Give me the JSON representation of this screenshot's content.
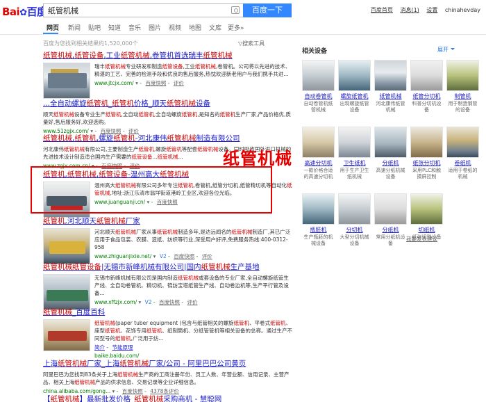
{
  "header": {
    "logo_part1": "Bai",
    "logo_paw": "✿",
    "logo_part2": "百度",
    "query": "纸管机械",
    "search_button": "百度一下",
    "links": [
      "百度首页",
      "消息(1)",
      "设置",
      "chinahevday"
    ],
    "icons": {
      "camera": "camera-icon"
    }
  },
  "nav": {
    "tabs": [
      "网页",
      "新闻",
      "贴吧",
      "知道",
      "音乐",
      "图片",
      "视频",
      "地图",
      "文库",
      "更多»"
    ],
    "active_index": 0
  },
  "result_count": "百度为您找到相关结果约1,520,000个",
  "search_tools": "搜索工具",
  "results": [
    {
      "title": "纸管机械,纸管设备,工业纸管机械,卷管机首选瑞丰纸管机械",
      "abstract": "瑞丰纸管机械专业研发和制造纸管设备,工业纸管机械,卷管机。公司将以先进的技术、精湛的工艺、完善的检测手段和优良的售后服务,热忱欢迎新老用户与我们携手共进...",
      "url": "www.jtcjx.com/",
      "snapshot": "百度快照",
      "extra": "评价"
    },
    {
      "title": "...全自动螺旋纸管机_纸管机价格_顺天纸管机械设备",
      "abstract": "顺天纸管机械设备专业生产纸管机,全自动纸管机,全自动螺旋纸管机,是知名的纸管机生产厂家,产品价格优,质量好,售后服务好,欢迎选购。",
      "url": "www.51zgjx.com/",
      "snapshot": "百度快照",
      "extra": "评价"
    },
    {
      "title": "纸管机械,纸管机,螺旋纸管机-河北康伟纸管机械制造有限公司",
      "abstract": "河北康伟纸管机械有限公司,主要制造生产纸管机,螺旋纸管机等配套纸管机械设备。同时吸收国外进口机械的先进技术设计制造适合国内生产需要的纸管设备...纸管机械...",
      "url": "www.zgjx.com.cn/",
      "snapshot": "百度快照",
      "extra": "评价"
    },
    {
      "title": "纸管机,纸管机械,纸管设备-温州高大纸管机械",
      "abstract": "温州高大纸管机械有限公司多年专注纸管机,卷管机,纸管分切机,纸管精切机等自动化纸管机械,地址:浙江乐清市翁垟街道港岭工业区,欢迎各位光临。",
      "url": "www.juanguanji.cn/",
      "snapshot": "百度快照",
      "extra": ""
    },
    {
      "title": "纸管机,河北顺天纸管机械厂家",
      "abstract": "河北顺天纸管机械厂家从事纸管机械制造多年,是达远闻名的纸管机械制造厂,其已广泛应用于食品包装、农膜、造纸、纺织等行业,深受用户好评,免费服务热线:400-0312-958",
      "url": "www.zhiguanjixie.net/",
      "v2": "V2",
      "snapshot": "百度快照",
      "extra": "评价"
    },
    {
      "title": "纸管机械纸管设备|无锡市新峰机械有限公司|国内纸管机械生产基地",
      "abstract": "无锡市新峰机械有限公司是国内制造纸管机械或套设备的专业厂家,全自动螺旋纸管生产线、全自动卷管机、精切机、锦纺宝塔纸管生产线、自动卷边机等,生产平行管及设备...",
      "url": "www.xffzjx.com/",
      "v2": "V2",
      "snapshot": "百度快照",
      "extra": "评价"
    },
    {
      "title": "纸管机械_百度百科",
      "abstract": "纸管机械(paper tuber equipment )包含与纸管相关的螺旋纸管机、平卷式纸管机、座型纸管机、花饰专用纸管机、纸制筒机、分纸管管机等相关设备的总称。通过生产不同型号的纸管机,广泛用于纺...",
      "links": [
        "简介",
        "节能原理"
      ],
      "url": "baike.baidu.com/",
      "snapshot": "",
      "extra": ""
    },
    {
      "title": "上海纸管机械厂家_上海纸管机械厂家/公司 - 阿里巴巴公司黄页",
      "abstract": "阿里巴巴为您找到83条关于上海纸管机械生产商的工商注册年份、员工人数、年营业额、信用记录、主营产品、相关上海纸管机械产品的供求信息、交易记录等企业详细信息。",
      "url": "china.alibaba.com/gong...",
      "snapshot": "百度快照",
      "extra": "4378条评价"
    },
    {
      "title": "【纸管机械】最新批发价格_纸管机械采购商机 - 慧聪网",
      "abstract": "",
      "url": "",
      "snapshot": "",
      "extra": ""
    }
  ],
  "annotation": "纸管机械",
  "sidebar": {
    "title": "相关设备",
    "expand": "展开",
    "items": [
      {
        "name": "自动卷管机",
        "desc": "自动卷管机纸管机械"
      },
      {
        "name": "螺旋纸管机",
        "desc": "出现螺旋纸管设备"
      },
      {
        "name": "纸管机械",
        "desc": "河北康伟纸管机械"
      },
      {
        "name": "纸管分切机",
        "desc": "科普分切机设备"
      },
      {
        "name": "制管机",
        "desc": "用于制造钢管的设备"
      },
      {
        "name": "高速分切机",
        "desc": "一款价格合适的高速分切机"
      },
      {
        "name": "卫生纸机",
        "desc": "用于生产卫生纸机械"
      },
      {
        "name": "分纸机",
        "desc": "高速分纸机械设备"
      },
      {
        "name": "纸张分切机",
        "desc": "采用PLC和触摸屏控制"
      },
      {
        "name": "卷纸机",
        "desc": "适用于卷纸的机械"
      },
      {
        "name": "瓶胚机",
        "desc": "生产瓶胚的机械设备"
      },
      {
        "name": "分切机",
        "desc": "大型分切机械设备"
      },
      {
        "name": "分纸机",
        "desc": "常用分纸机设备"
      },
      {
        "name": "切纸机",
        "desc": "纸张切割设备"
      }
    ],
    "feedback": "我要发表建议"
  }
}
